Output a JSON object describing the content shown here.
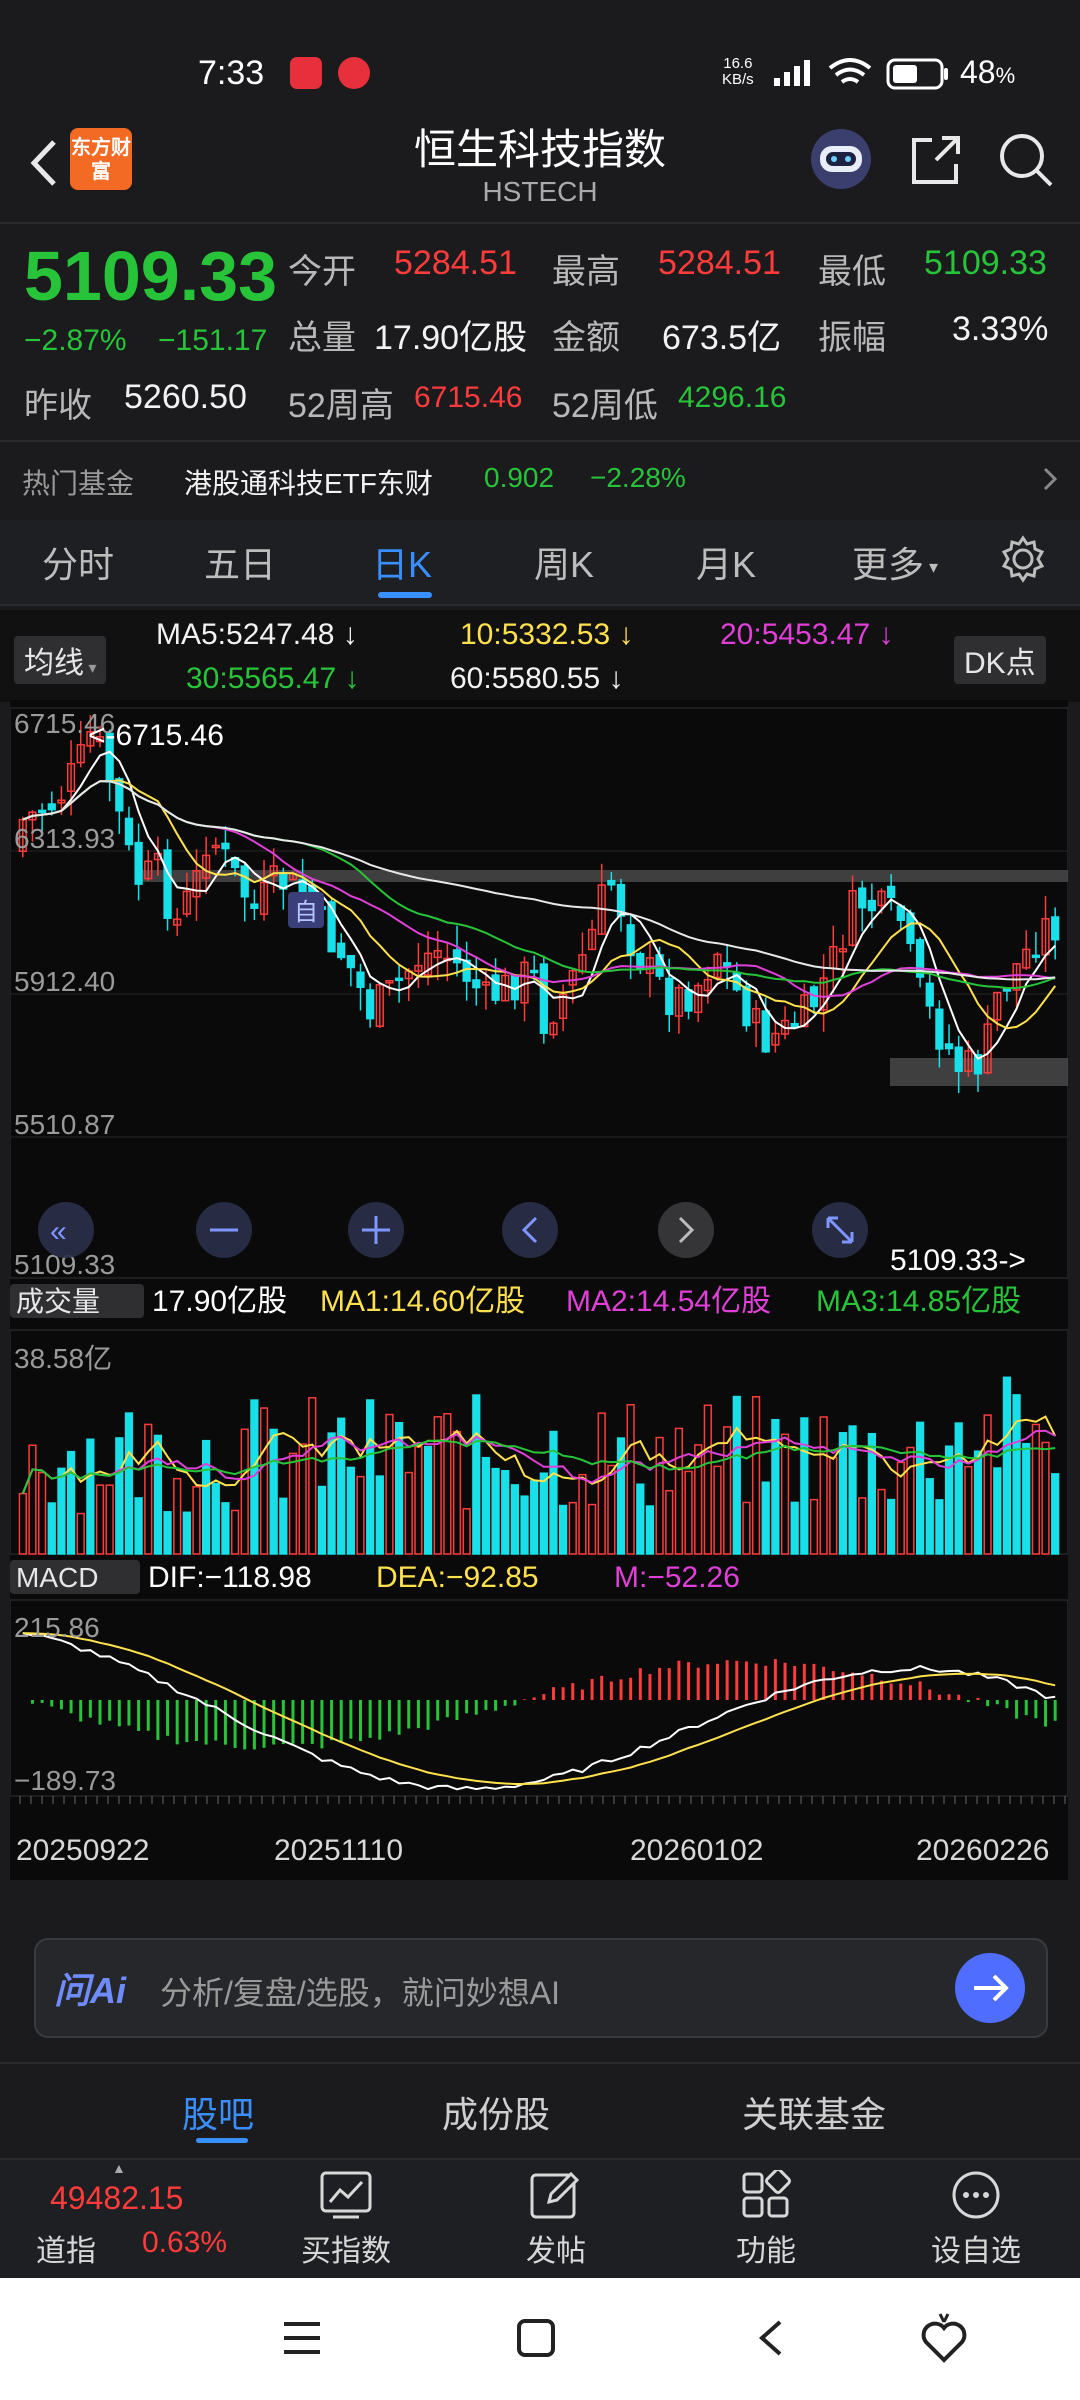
{
  "status": {
    "time": "7:33",
    "net_speed": "16.6",
    "net_unit": "KB/s",
    "battery": "48",
    "battery_unit": "%"
  },
  "header": {
    "logo_text": "东方财富",
    "title": "恒生科技指数",
    "subtitle": "HSTECH"
  },
  "quote": {
    "price": "5109.33",
    "change_pct": "−2.87%",
    "change": "−151.17",
    "open_label": "今开",
    "open": "5284.51",
    "high_label": "最高",
    "high": "5284.51",
    "low_label": "最低",
    "low": "5109.33",
    "volume_label": "总量",
    "volume": "17.90亿股",
    "amount_label": "金额",
    "amount": "673.5亿",
    "amplitude_label": "振幅",
    "amplitude": "3.33%",
    "prev_close_label": "昨收",
    "prev_close": "5260.50",
    "week52_high_label": "52周高",
    "week52_high": "6715.46",
    "week52_low_label": "52周低",
    "week52_low": "4296.16"
  },
  "hot_fund": {
    "label": "热门基金",
    "name": "港股通科技ETF东财",
    "price": "0.902",
    "change": "−2.28%"
  },
  "tabs": [
    "分时",
    "五日",
    "日K",
    "周K",
    "月K",
    "更多"
  ],
  "ma": {
    "selector": "均线",
    "ma5": "MA5:5247.48",
    "ma10": "10:5332.53",
    "ma20": "20:5453.47",
    "ma30": "30:5565.47",
    "ma60": "60:5580.55",
    "dk": "DK点"
  },
  "kchart": {
    "y_labels": [
      "6715.46",
      "6313.93",
      "5912.40",
      "5510.87",
      "5109.33"
    ],
    "max_marker": "<-6715.46",
    "last_marker": "5109.33->",
    "self_badge": "自"
  },
  "volume": {
    "selector": "成交量",
    "value": "17.90亿股",
    "ma1": "MA1:14.60亿股",
    "ma2": "MA2:14.54亿股",
    "ma3": "MA3:14.85亿股",
    "y_label": "38.58亿"
  },
  "macd": {
    "selector": "MACD",
    "dif": "DIF:−118.98",
    "dea": "DEA:−92.85",
    "m": "M:−52.26",
    "y_top": "215.86",
    "y_bottom": "−189.73"
  },
  "dates": [
    "20250922",
    "20251110",
    "20260102",
    "20260226"
  ],
  "ai": {
    "brand": "问Ai",
    "placeholder": "分析/复盘/选股，就问妙想AI"
  },
  "bottom_tabs": [
    "股吧",
    "成份股",
    "关联基金"
  ],
  "bottom_nav": {
    "index_value": "49482.15",
    "index_name": "道指",
    "index_change": "0.63%",
    "items": [
      "买指数",
      "发帖",
      "功能",
      "设自选"
    ]
  },
  "colors": {
    "up": "#ff3b3b",
    "down": "#27c43a",
    "accent": "#3a8fff",
    "ma5": "#ffffff",
    "ma10": "#ffe14d",
    "ma20": "#e040d8",
    "ma30": "#27c43a",
    "candle_down": "#19e0e8",
    "candle_up": "#ff3b3b"
  }
}
